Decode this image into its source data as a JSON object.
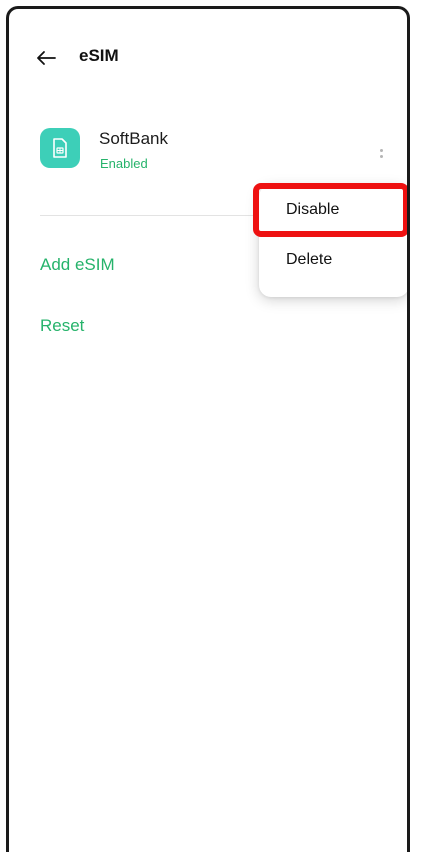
{
  "header": {
    "title": "eSIM",
    "back_icon": "arrow-left-icon"
  },
  "sim": {
    "name": "SoftBank",
    "status": "Enabled",
    "icon": "sim-card-icon",
    "icon_color": "#3dcfb8",
    "more_icon": "more-vertical-icon"
  },
  "links": {
    "add_esim": "Add eSIM",
    "reset": "Reset"
  },
  "menu": {
    "items": [
      {
        "label": "Disable",
        "highlighted": true
      },
      {
        "label": "Delete"
      }
    ]
  },
  "colors": {
    "accent": "#26b36b",
    "highlight": "#ee1111"
  }
}
